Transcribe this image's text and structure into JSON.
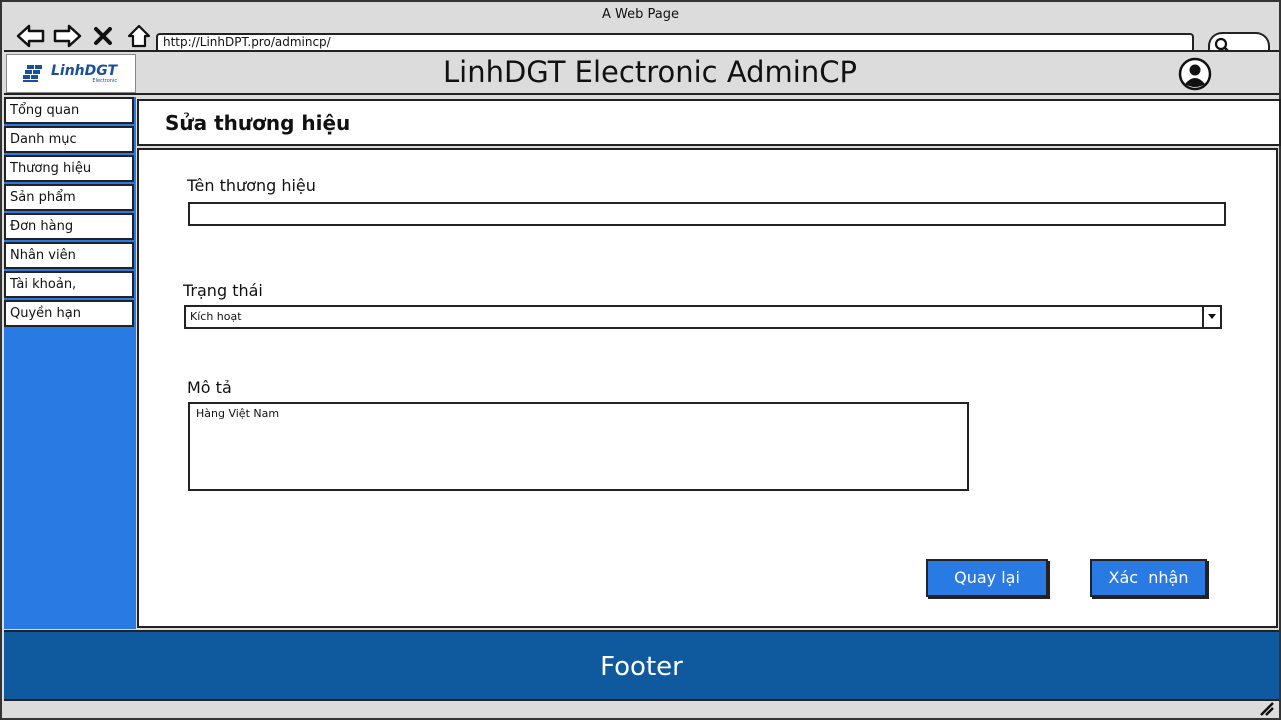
{
  "browser": {
    "window_title": "A Web Page",
    "url": "http://LinhDPT.pro/admincp/"
  },
  "header": {
    "logo_text": "LinhDGT",
    "logo_subtext": "Electronic",
    "title": "LinhDGT Electronic AdminCP",
    "user_icon": "user-circle-icon"
  },
  "sidebar": {
    "items": [
      {
        "label": "Tổng quan"
      },
      {
        "label": "Danh mục"
      },
      {
        "label": "Thương hiệu"
      },
      {
        "label": "Sản phẩm"
      },
      {
        "label": "Đơn hàng"
      },
      {
        "label": "Nhân viên"
      },
      {
        "label": "Tài khoản,"
      },
      {
        "label": "Quyền hạn"
      }
    ]
  },
  "page": {
    "title": "Sửa thương hiệu"
  },
  "form": {
    "name_label": "Tên thương hiệu",
    "name_value": "",
    "status_label": "Trạng thái",
    "status_value": "Kích hoạt",
    "description_label": "Mô tả",
    "description_value": "Hàng Việt Nam",
    "back_label": "Quay lại",
    "confirm_label": "Xác  nhận"
  },
  "footer": {
    "text": "Footer"
  },
  "colors": {
    "sidebar_bg": "#2a7ae4",
    "button_bg": "#2a7ae4",
    "footer_bg": "#0f5a9e",
    "chrome_bg": "#dcdcdc"
  }
}
